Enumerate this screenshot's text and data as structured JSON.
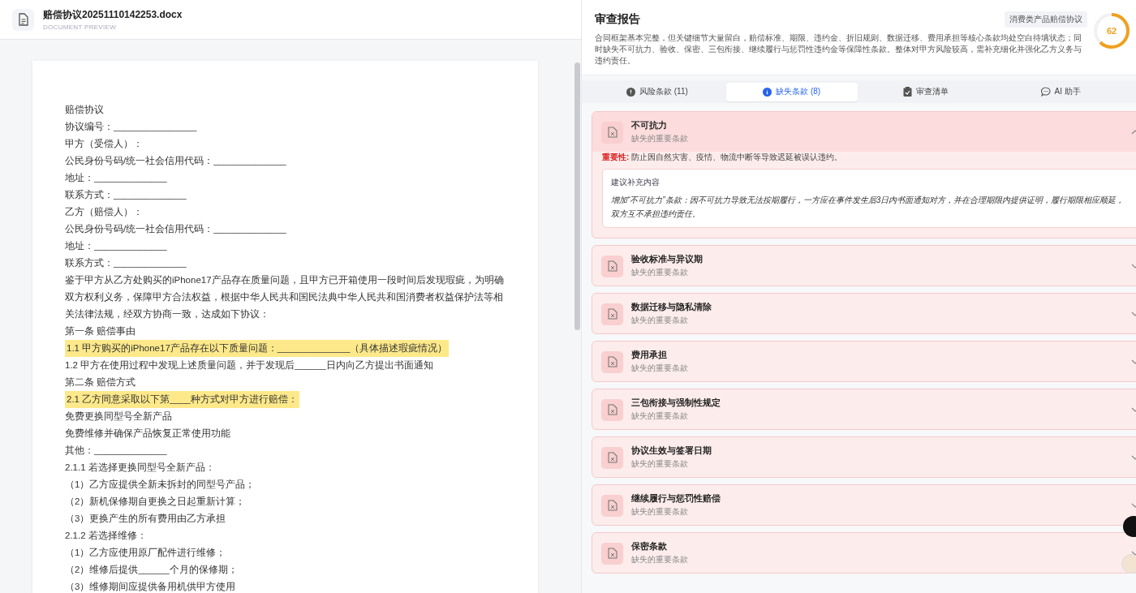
{
  "document": {
    "file_name": "赔偿协议20251110142253.docx",
    "subtitle": "DOCUMENT PREVIEW",
    "lines": [
      {
        "text": "赔偿协议",
        "highlighted": false
      },
      {
        "text": "协议编号：________________",
        "highlighted": false
      },
      {
        "text": "甲方（受偿人）：",
        "highlighted": false
      },
      {
        "text": "公民身份号码/统一社会信用代码：______________",
        "highlighted": false
      },
      {
        "text": "地址：______________",
        "highlighted": false
      },
      {
        "text": "联系方式：______________",
        "highlighted": false
      },
      {
        "text": "乙方（赔偿人）：",
        "highlighted": false
      },
      {
        "text": "公民身份号码/统一社会信用代码：______________",
        "highlighted": false
      },
      {
        "text": "地址：______________",
        "highlighted": false
      },
      {
        "text": "联系方式：______________",
        "highlighted": false
      },
      {
        "text": "鉴于甲方从乙方处购买的iPhone17产品存在质量问题，且甲方已开箱使用一段时间后发现瑕疵，为明确双方权利义务，保障甲方合法权益，根据中华人民共和国民法典中华人民共和国消费者权益保护法等相关法律法规，经双方协商一致，达成如下协议：",
        "highlighted": false
      },
      {
        "text": "第一条 赔偿事由",
        "highlighted": false
      },
      {
        "text": "1.1 甲方购买的iPhone17产品存在以下质量问题：______________（具体描述瑕疵情况）",
        "highlighted": true
      },
      {
        "text": "1.2 甲方在使用过程中发现上述质量问题，并于发现后______日内向乙方提出书面通知",
        "highlighted": false
      },
      {
        "text": "第二条 赔偿方式",
        "highlighted": false
      },
      {
        "text": "2.1 乙方同意采取以下第____种方式对甲方进行赔偿：",
        "highlighted": true
      },
      {
        "text": "免费更换同型号全新产品",
        "highlighted": false
      },
      {
        "text": "免费维修并确保产品恢复正常使用功能",
        "highlighted": false
      },
      {
        "text": "其他：______________",
        "highlighted": false
      },
      {
        "text": "2.1.1 若选择更换同型号全新产品：",
        "highlighted": false
      },
      {
        "text": "（1）乙方应提供全新未拆封的同型号产品；",
        "highlighted": false
      },
      {
        "text": "（2）新机保修期自更换之日起重新计算；",
        "highlighted": false
      },
      {
        "text": "（3）更换产生的所有费用由乙方承担",
        "highlighted": false
      },
      {
        "text": "2.1.2 若选择维修：",
        "highlighted": false
      },
      {
        "text": "（1）乙方应使用原厂配件进行维修；",
        "highlighted": false
      },
      {
        "text": "（2）维修后提供______个月的保修期；",
        "highlighted": false
      },
      {
        "text": "（3）维修期间应提供备用机供甲方使用",
        "highlighted": false
      }
    ]
  },
  "report": {
    "title": "审查报告",
    "tag": "消费类产品赔偿协议",
    "summary": "合同框架基本完整，但关键细节大量留白，赔偿标准、期限、违约金、折旧规则、数据迁移、费用承担等核心条款均处空白待填状态；同时缺失不可抗力、验收、保密、三包衔接、继续履行与惩罚性违约金等保障性条款。整体对甲方风险较高，需补充细化并强化乙方义务与违约责任。",
    "score": {
      "value": "62",
      "level": 0.62
    },
    "tabs": [
      {
        "kind": "alert",
        "label": "风险条款 (11)",
        "selected": false
      },
      {
        "kind": "info",
        "label": "缺失条款 (8)",
        "selected": true
      },
      {
        "kind": "clipboard",
        "label": "审查清单",
        "selected": false
      },
      {
        "kind": "chat",
        "label": "AI 助手",
        "selected": false
      }
    ],
    "items": [
      {
        "title": "不可抗力",
        "subtitle": "缺失的重要条款",
        "expanded": true,
        "importance_label": "重要性:",
        "importance": "防止因自然灾害、疫情、物流中断等导致迟延被误认违约。",
        "suggestion_label": "建议补充内容",
        "suggestion": "增加“不可抗力”条款：因不可抗力导致无法按期履行，一方应在事件发生后3日内书面通知对方，并在合理期限内提供证明，履行期限相应顺延，双方互不承担违约责任。"
      },
      {
        "title": "验收标准与异议期",
        "subtitle": "缺失的重要条款",
        "expanded": false
      },
      {
        "title": "数据迁移与隐私清除",
        "subtitle": "缺失的重要条款",
        "expanded": false
      },
      {
        "title": "费用承担",
        "subtitle": "缺失的重要条款",
        "expanded": false
      },
      {
        "title": "三包衔接与强制性规定",
        "subtitle": "缺失的重要条款",
        "expanded": false
      },
      {
        "title": "协议生效与签署日期",
        "subtitle": "缺失的重要条款",
        "expanded": false
      },
      {
        "title": "继续履行与惩罚性赔偿",
        "subtitle": "缺失的重要条款",
        "expanded": false
      },
      {
        "title": "保密条款",
        "subtitle": "缺失的重要条款",
        "expanded": false
      }
    ]
  }
}
